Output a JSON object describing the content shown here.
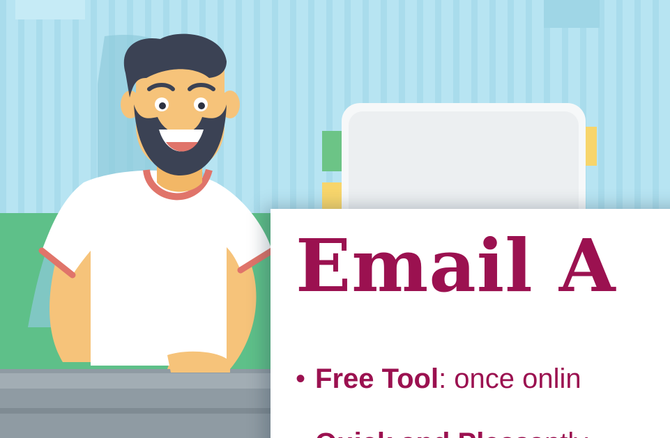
{
  "card": {
    "title": "Email A",
    "bullets": [
      {
        "dot": "•",
        "term": "Free Tool",
        "rest": ": once onlin"
      },
      {
        "dot": "•",
        "term": "Quick and Ple",
        "rest": "asantly"
      }
    ]
  },
  "colors": {
    "wall": "#b7e4f2",
    "stripe": "#a6d9ea",
    "accent": "#9b1150",
    "shirt": "#ffffff",
    "shirt_trim": "#e0746a",
    "skin": "#f6c37a",
    "hair": "#3b4254",
    "desk": "#8f9ba3",
    "sofa": "#5ec089",
    "sticky_yellow": "#f7d56b",
    "sticky_green": "#6cc486"
  },
  "icons": [
    "man-illustration",
    "monitor-illustration",
    "sticky-note"
  ]
}
